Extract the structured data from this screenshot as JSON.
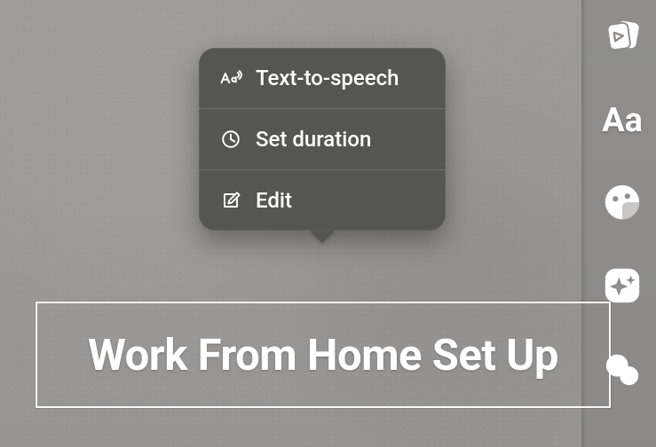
{
  "caption": {
    "text": "Work From Home Set Up"
  },
  "popover": {
    "items": [
      {
        "icon": "text-to-speech",
        "label": "Text-to-speech"
      },
      {
        "icon": "clock",
        "label": "Set duration"
      },
      {
        "icon": "edit",
        "label": "Edit"
      }
    ]
  },
  "side_toolbar": {
    "items": [
      {
        "name": "templates",
        "glyph": ""
      },
      {
        "name": "text",
        "glyph": "Aa"
      },
      {
        "name": "stickers",
        "glyph": ""
      },
      {
        "name": "effects",
        "glyph": ""
      },
      {
        "name": "overlay",
        "glyph": ""
      }
    ]
  }
}
